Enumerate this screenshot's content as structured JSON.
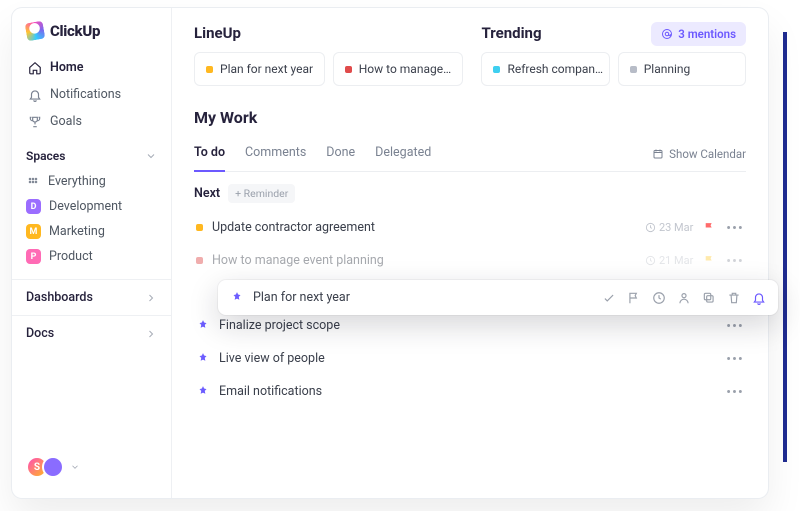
{
  "brand": {
    "name": "ClickUp"
  },
  "nav": {
    "home": "Home",
    "notifications": "Notifications",
    "goals": "Goals"
  },
  "spaces": {
    "header": "Spaces",
    "everything": "Everything",
    "items": [
      {
        "label": "Development",
        "letter": "D",
        "color": "#9b6dff"
      },
      {
        "label": "Marketing",
        "letter": "M",
        "color": "#ffb820"
      },
      {
        "label": "Product",
        "letter": "P",
        "color": "#ff6bb5"
      }
    ]
  },
  "collapsibles": {
    "dashboards": "Dashboards",
    "docs": "Docs"
  },
  "mentions": {
    "label": "3 mentions"
  },
  "columns": {
    "lineup": {
      "title": "LineUp",
      "cards": [
        {
          "label": "Plan for next year",
          "color": "#ffb820"
        },
        {
          "label": "How to manage…",
          "color": "#e04b4b"
        }
      ]
    },
    "trending": {
      "title": "Trending",
      "cards": [
        {
          "label": "Refresh compan…",
          "color": "#3ecff0"
        },
        {
          "label": "Planning",
          "color": "#b7bcc7"
        }
      ]
    }
  },
  "mywork": {
    "title": "My Work",
    "tabs": [
      "To do",
      "Comments",
      "Done",
      "Delegated"
    ],
    "active_tab": 0,
    "show_calendar": "Show Calendar",
    "next_label": "Next",
    "reminder_chip": "+ Reminder",
    "tasks": [
      {
        "icon": "dot",
        "color": "#ffb820",
        "label": "Update contractor agreement",
        "date": "23 Mar",
        "flag": "#ff6b6b",
        "more": true
      },
      {
        "icon": "dot",
        "color": "#e04b4b",
        "label": "How to manage event planning",
        "date": "21 Mar",
        "flag": "#ffd24a",
        "more": true,
        "faded": true
      },
      {
        "icon": "hand",
        "label": "Finalize project scope",
        "more": true
      },
      {
        "icon": "hand",
        "label": "Live view of people",
        "more": true
      },
      {
        "icon": "hand",
        "label": "Email notifications",
        "more": true
      }
    ]
  },
  "floating": {
    "label": "Plan for next year"
  }
}
